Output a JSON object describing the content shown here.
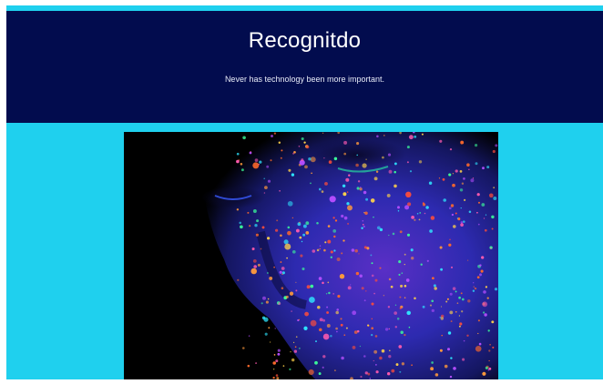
{
  "header": {
    "title": "Recognitdo",
    "tagline": "Never has technology been more important."
  },
  "hero_image": {
    "icon": "neon-face-image"
  },
  "colors": {
    "page_bg": "#1fd0ee",
    "header_bg": "#020c4e",
    "text": "#ffffff"
  }
}
